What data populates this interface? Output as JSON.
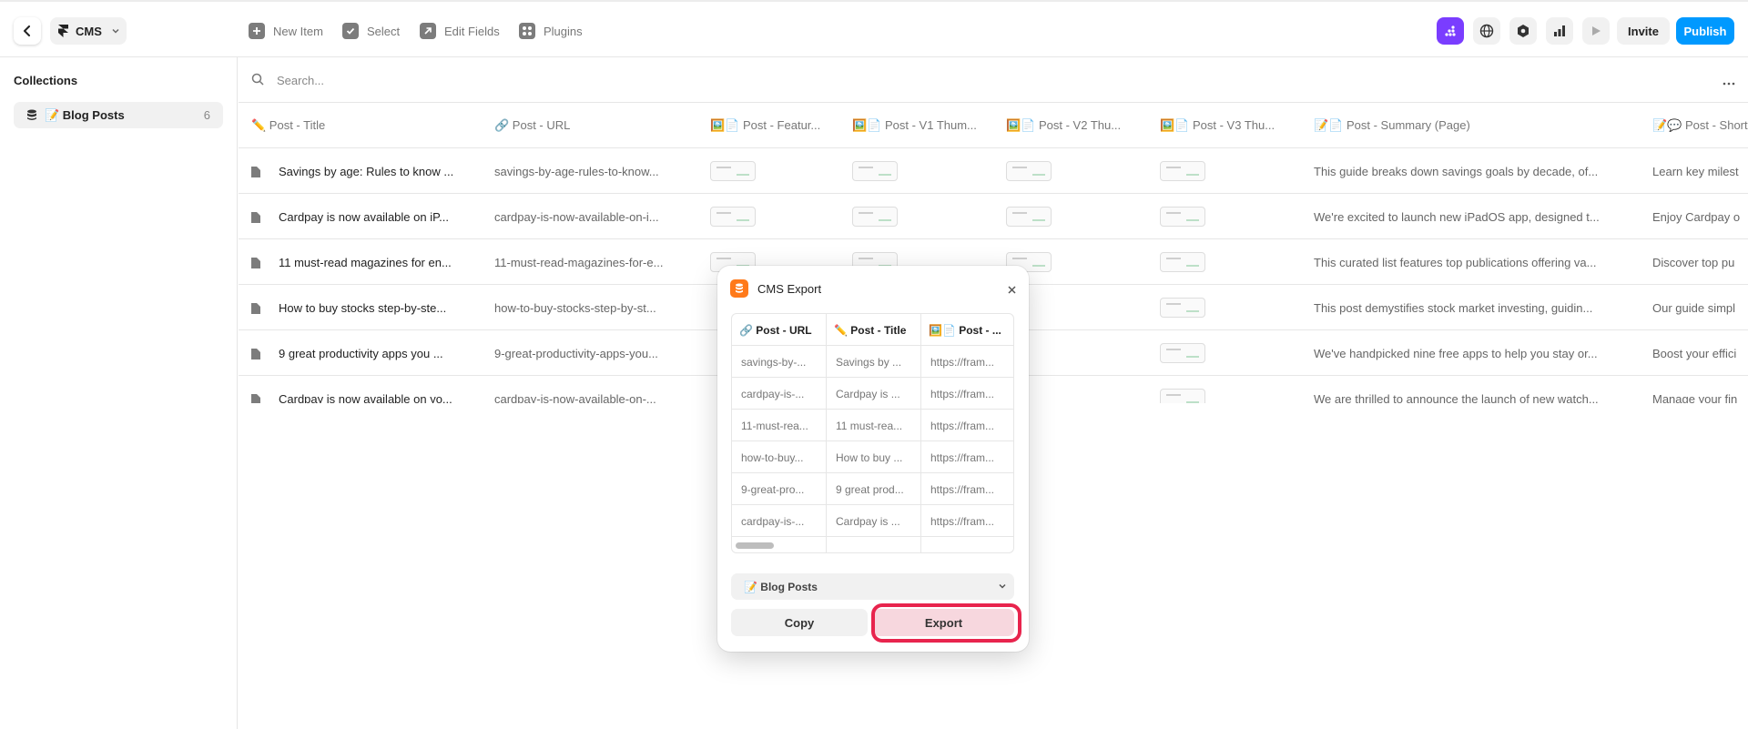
{
  "toolbar": {
    "cms_label": "CMS",
    "new_item_label": "New Item",
    "select_label": "Select",
    "edit_fields_label": "Edit Fields",
    "plugins_label": "Plugins",
    "invite_label": "Invite",
    "publish_label": "Publish"
  },
  "sidebar": {
    "title": "Collections",
    "items": [
      {
        "label": "📝 Blog Posts",
        "count": "6"
      }
    ]
  },
  "search": {
    "placeholder": "Search..."
  },
  "table": {
    "columns": [
      "✏️ Post - Title",
      "🔗 Post - URL",
      "🖼️📄 Post - Featur...",
      "🖼️📄 Post - V1 Thum...",
      "🖼️📄 Post - V2 Thu...",
      "🖼️📄 Post - V3 Thu...",
      "📝📄 Post - Summary (Page)",
      "📝💬 Post - Short"
    ],
    "rows": [
      {
        "title": "Savings by age: Rules to know ...",
        "url": "savings-by-age-rules-to-know...",
        "summary": "This guide breaks down savings goals by decade, of...",
        "short": "Learn key milest"
      },
      {
        "title": "Cardpay is now available on iP...",
        "url": "cardpay-is-now-available-on-i...",
        "summary": "We're excited to launch new iPadOS app, designed t...",
        "short": "Enjoy Cardpay o"
      },
      {
        "title": "11 must-read magazines for en...",
        "url": "11-must-read-magazines-for-e...",
        "summary": "This curated list features top publications offering va...",
        "short": "Discover top pu"
      },
      {
        "title": "How to buy stocks step-by-ste...",
        "url": "how-to-buy-stocks-step-by-st...",
        "summary": "This post demystifies stock market investing, guidin...",
        "short": "Our guide simpl"
      },
      {
        "title": "9 great productivity apps you ...",
        "url": "9-great-productivity-apps-you...",
        "summary": "We've handpicked nine free apps to help you stay or...",
        "short": "Boost your effici"
      },
      {
        "title": "Cardpay is now available on yo...",
        "url": "cardpay-is-now-available-on-...",
        "summary": "We are thrilled to announce the launch of new watch...",
        "short": "Manage your fin"
      }
    ]
  },
  "modal": {
    "title": "CMS Export",
    "columns": [
      "🔗 Post - URL",
      "✏️ Post - Title",
      "🖼️📄 Post - ..."
    ],
    "rows": [
      [
        "savings-by-...",
        "Savings by ...",
        "https://fram..."
      ],
      [
        "cardpay-is-...",
        "Cardpay is ...",
        "https://fram..."
      ],
      [
        "11-must-rea...",
        "11 must-rea...",
        "https://fram..."
      ],
      [
        "how-to-buy...",
        "How to buy ...",
        "https://fram..."
      ],
      [
        "9-great-pro...",
        "9 great prod...",
        "https://fram..."
      ],
      [
        "cardpay-is-...",
        "Cardpay is ...",
        "https://fram..."
      ]
    ],
    "collection_select": "📝 Blog Posts",
    "copy_label": "Copy",
    "export_label": "Export"
  },
  "colors": {
    "accent_purple": "#7a3dff",
    "publish_blue": "#0099ff",
    "export_highlight": "#e8244d",
    "modal_logo_orange": "#ff7a1a"
  }
}
